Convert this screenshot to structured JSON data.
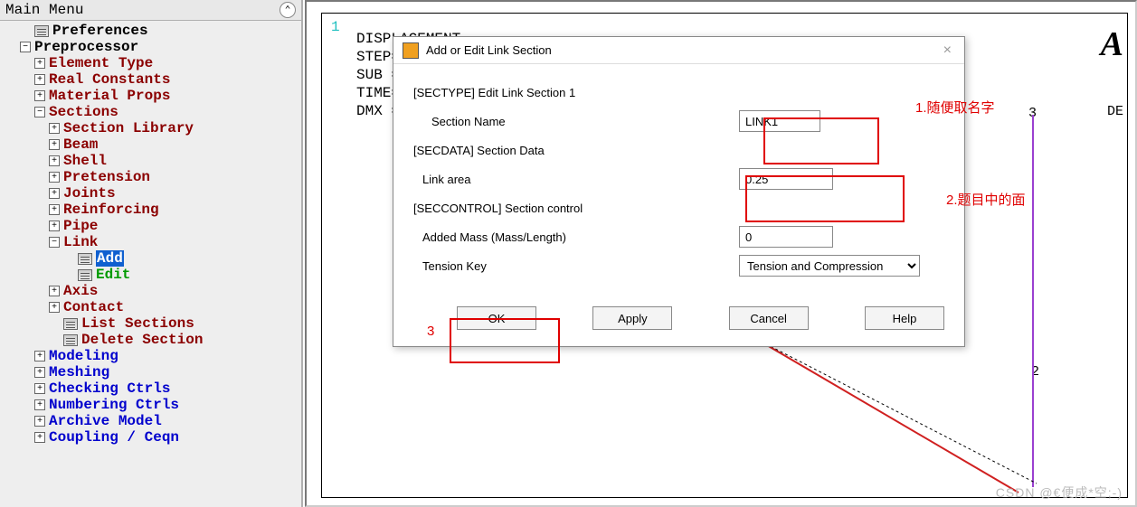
{
  "left": {
    "header": "Main Menu",
    "tree": [
      {
        "indent": 1,
        "box": "",
        "icon": true,
        "text": "Preferences",
        "cls": "c-black"
      },
      {
        "indent": 1,
        "box": "-",
        "icon": false,
        "text": "Preprocessor",
        "cls": "c-black"
      },
      {
        "indent": 2,
        "box": "+",
        "icon": false,
        "text": "Element Type",
        "cls": "c-darkred"
      },
      {
        "indent": 2,
        "box": "+",
        "icon": false,
        "text": "Real Constants",
        "cls": "c-darkred"
      },
      {
        "indent": 2,
        "box": "+",
        "icon": false,
        "text": "Material Props",
        "cls": "c-darkred"
      },
      {
        "indent": 2,
        "box": "-",
        "icon": false,
        "text": "Sections",
        "cls": "c-darkred"
      },
      {
        "indent": 3,
        "box": "+",
        "icon": false,
        "text": "Section Library",
        "cls": "c-darkred"
      },
      {
        "indent": 3,
        "box": "+",
        "icon": false,
        "text": "Beam",
        "cls": "c-darkred"
      },
      {
        "indent": 3,
        "box": "+",
        "icon": false,
        "text": "Shell",
        "cls": "c-darkred"
      },
      {
        "indent": 3,
        "box": "+",
        "icon": false,
        "text": "Pretension",
        "cls": "c-darkred"
      },
      {
        "indent": 3,
        "box": "+",
        "icon": false,
        "text": "Joints",
        "cls": "c-darkred"
      },
      {
        "indent": 3,
        "box": "+",
        "icon": false,
        "text": "Reinforcing",
        "cls": "c-darkred"
      },
      {
        "indent": 3,
        "box": "+",
        "icon": false,
        "text": "Pipe",
        "cls": "c-darkred"
      },
      {
        "indent": 3,
        "box": "-",
        "icon": false,
        "text": "Link",
        "cls": "c-darkred"
      },
      {
        "indent": 4,
        "box": "",
        "icon": true,
        "text": "Add",
        "cls": "c-blue",
        "sel": true
      },
      {
        "indent": 4,
        "box": "",
        "icon": true,
        "text": "Edit",
        "cls": "c-green"
      },
      {
        "indent": 3,
        "box": "+",
        "icon": false,
        "text": "Axis",
        "cls": "c-darkred"
      },
      {
        "indent": 3,
        "box": "+",
        "icon": false,
        "text": "Contact",
        "cls": "c-darkred"
      },
      {
        "indent": 3,
        "box": "",
        "icon": true,
        "text": "List Sections",
        "cls": "c-darkred"
      },
      {
        "indent": 3,
        "box": "",
        "icon": true,
        "text": "Delete Section",
        "cls": "c-darkred"
      },
      {
        "indent": 2,
        "box": "+",
        "icon": false,
        "text": "Modeling",
        "cls": "c-blue"
      },
      {
        "indent": 2,
        "box": "+",
        "icon": false,
        "text": "Meshing",
        "cls": "c-blue"
      },
      {
        "indent": 2,
        "box": "+",
        "icon": false,
        "text": "Checking Ctrls",
        "cls": "c-blue"
      },
      {
        "indent": 2,
        "box": "+",
        "icon": false,
        "text": "Numbering Ctrls",
        "cls": "c-blue"
      },
      {
        "indent": 2,
        "box": "+",
        "icon": false,
        "text": "Archive Model",
        "cls": "c-blue"
      },
      {
        "indent": 2,
        "box": "+",
        "icon": false,
        "text": "Coupling / Ceqn",
        "cls": "c-blue"
      }
    ]
  },
  "canvas": {
    "line1": "DISPLACEMENT",
    "line2": "STEP=",
    "line3": "SUB =",
    "line4": "TIME=",
    "line5": "DMX =",
    "cyan": "1",
    "num3": "3",
    "num2": "2",
    "de": "DE",
    "acorner": "A"
  },
  "dialog": {
    "title": "Add or Edit Link Section",
    "sectype": "[SECTYPE]  Edit Link Section 1",
    "name_label": "Section Name",
    "name_value": "LINK1",
    "secdata": "[SECDATA] Section Data",
    "area_label": "Link area",
    "area_value": "0.25",
    "seccontrol": "[SECCONTROL] Section control",
    "mass_label": "Added Mass (Mass/Length)",
    "mass_value": "0",
    "tension_label": "Tension Key",
    "tension_value": "Tension and Compression",
    "ok": "OK",
    "apply": "Apply",
    "cancel": "Cancel",
    "help": "Help"
  },
  "annot": {
    "a1": "1.随便取名字",
    "a2": "2.题目中的面",
    "a3": "3"
  },
  "watermark": "CSDN @€便成*空;-)"
}
